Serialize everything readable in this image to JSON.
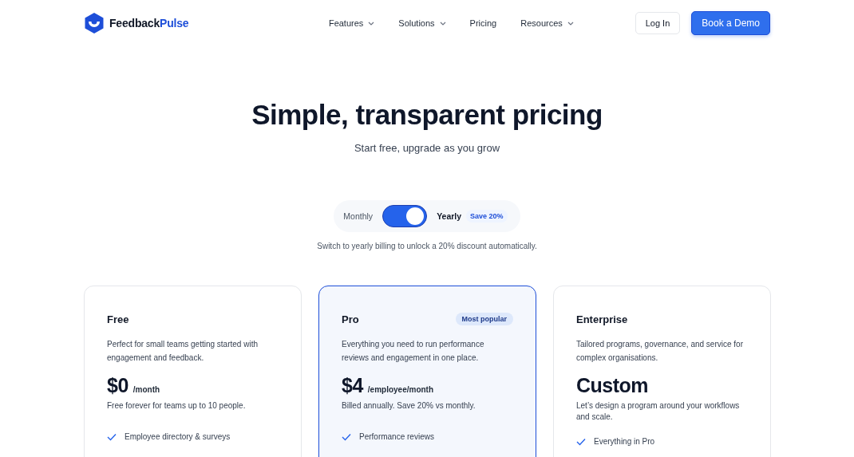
{
  "brand": {
    "name_first": "Feedback",
    "name_second": "Pulse"
  },
  "nav": [
    {
      "label": "Features",
      "dropdown": true
    },
    {
      "label": "Solutions",
      "dropdown": true
    },
    {
      "label": "Pricing",
      "dropdown": false
    },
    {
      "label": "Resources",
      "dropdown": true
    }
  ],
  "actions": {
    "login": "Log In",
    "demo": "Book a Demo"
  },
  "hero": {
    "title": "Simple, transparent pricing",
    "subtitle": "Start free, upgrade as you grow"
  },
  "billing": {
    "monthly_label": "Monthly",
    "yearly_label": "Yearly",
    "on": true,
    "badge": "Save 20%",
    "note": "Switch to yearly billing to unlock a 20% discount automatically."
  },
  "plans": [
    {
      "name": "Free",
      "highlighted": false,
      "description": "Perfect for small teams getting started with engagement and feedback.",
      "price": "$0",
      "unit": "/month",
      "price_note": "Free forever for teams up to 10 people.",
      "features": [
        "Employee directory & surveys"
      ]
    },
    {
      "name": "Pro",
      "highlighted": true,
      "badge": "Most popular",
      "description": "Everything you need to run performance reviews and engagement in one place.",
      "price": "$4",
      "unit": "/employee/month",
      "price_note": "Billed annually. Save 20% vs monthly.",
      "features": [
        "Performance reviews"
      ]
    },
    {
      "name": "Enterprise",
      "highlighted": false,
      "description": "Tailored programs, governance, and service for complex organisations.",
      "price": "Custom",
      "price_note": "Let’s design a program around your workflows and scale.",
      "features": [
        "Everything in Pro"
      ]
    }
  ]
}
